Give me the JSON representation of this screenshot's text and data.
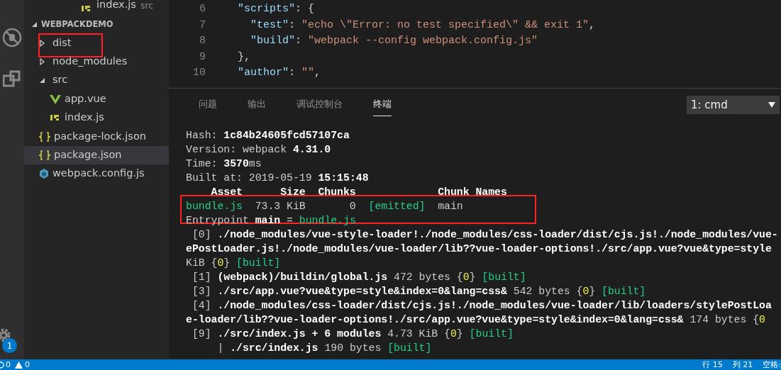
{
  "activity_bar": {
    "badge": "1"
  },
  "open_editor": {
    "name": "index.js",
    "kind": "js",
    "description": "src"
  },
  "explorer": {
    "title": "WEBPACKDEMO",
    "expanded": true,
    "items": [
      {
        "name": "dist",
        "kind": "folder",
        "expanded": false,
        "selected": false,
        "highlighted": true
      },
      {
        "name": "node_modules",
        "kind": "folder",
        "expanded": false,
        "selected": false,
        "highlighted": false
      },
      {
        "name": "src",
        "kind": "folder",
        "expanded": true,
        "selected": false,
        "highlighted": false,
        "children": [
          {
            "name": "app.vue",
            "kind": "vue",
            "selected": false,
            "highlighted": false
          },
          {
            "name": "index.js",
            "kind": "js",
            "selected": false,
            "highlighted": false
          }
        ]
      },
      {
        "name": "package-lock.json",
        "kind": "json",
        "selected": false,
        "highlighted": false
      },
      {
        "name": "package.json",
        "kind": "json",
        "selected": true,
        "highlighted": false
      },
      {
        "name": "webpack.config.js",
        "kind": "webpack",
        "selected": false,
        "highlighted": false
      }
    ]
  },
  "editor": {
    "lines": [
      {
        "number": "6",
        "tokens": [
          {
            "text": "  \"scripts\"",
            "kind": "key"
          },
          {
            "text": ": {",
            "kind": "punct"
          }
        ]
      },
      {
        "number": "7",
        "tokens": [
          {
            "text": "    \"test\"",
            "kind": "key"
          },
          {
            "text": ": ",
            "kind": "punct"
          },
          {
            "text": "\"echo \\\"Error: no test specified\\\" && exit 1\"",
            "kind": "string"
          },
          {
            "text": ",",
            "kind": "punct"
          }
        ]
      },
      {
        "number": "8",
        "tokens": [
          {
            "text": "    \"build\"",
            "kind": "key"
          },
          {
            "text": ": ",
            "kind": "punct"
          },
          {
            "text": "\"webpack --config webpack.config.js\"",
            "kind": "string"
          }
        ]
      },
      {
        "number": "9",
        "tokens": [
          {
            "text": "  },",
            "kind": "punct"
          }
        ]
      },
      {
        "number": "10",
        "tokens": [
          {
            "text": "  \"author\"",
            "kind": "key"
          },
          {
            "text": ": ",
            "kind": "punct"
          },
          {
            "text": "\"\"",
            "kind": "string"
          },
          {
            "text": ",",
            "kind": "punct"
          }
        ]
      }
    ]
  },
  "panel": {
    "tabs": [
      {
        "label": "问题",
        "selected": false
      },
      {
        "label": "输出",
        "selected": false
      },
      {
        "label": "调试控制台",
        "selected": false
      },
      {
        "label": "终端",
        "selected": true
      }
    ],
    "terminal_select": "1: cmd",
    "terminal_lines": [
      {
        "highlighted": false,
        "segments": [
          {
            "text": "Hash: ",
            "kind": "plain"
          },
          {
            "text": "1c84b24605fcd57107ca",
            "kind": "bold"
          }
        ]
      },
      {
        "highlighted": false,
        "segments": [
          {
            "text": "Version: webpack ",
            "kind": "plain"
          },
          {
            "text": "4.31.0",
            "kind": "bold"
          }
        ]
      },
      {
        "highlighted": false,
        "segments": [
          {
            "text": "Time: ",
            "kind": "plain"
          },
          {
            "text": "3570",
            "kind": "bold"
          },
          {
            "text": "ms",
            "kind": "plain"
          }
        ]
      },
      {
        "highlighted": false,
        "segments": [
          {
            "text": "Built at: 2019-05-19 ",
            "kind": "plain"
          },
          {
            "text": "15:15:48",
            "kind": "bold"
          }
        ]
      },
      {
        "highlighted": false,
        "segments": [
          {
            "text": "    Asset      Size  Chunks             Chunk Names",
            "kind": "bold"
          }
        ]
      },
      {
        "highlighted": true,
        "segments": [
          {
            "text": "bundle.js",
            "kind": "green"
          },
          {
            "text": "  73.3 KiB       0  ",
            "kind": "plain"
          },
          {
            "text": "[emitted]",
            "kind": "green"
          },
          {
            "text": "  main",
            "kind": "plain"
          }
        ]
      },
      {
        "highlighted": false,
        "segments": [
          {
            "text": "Entrypoint ",
            "kind": "plain"
          },
          {
            "text": "main",
            "kind": "bold"
          },
          {
            "text": " = ",
            "kind": "plain"
          },
          {
            "text": "bundle.js",
            "kind": "green"
          }
        ]
      },
      {
        "highlighted": false,
        "segments": [
          {
            "text": " [0] ",
            "kind": "plain"
          },
          {
            "text": "./node_modules/vue-style-loader!./node_modules/css-loader/dist/cjs.js!./node_modules/vue-",
            "kind": "bold"
          }
        ]
      },
      {
        "highlighted": false,
        "segments": [
          {
            "text": "ePostLoader.js!./node_modules/vue-loader/lib??vue-loader-options!./src/app.vue?vue&type=style",
            "kind": "bold"
          }
        ]
      },
      {
        "highlighted": false,
        "segments": [
          {
            "text": "KiB {",
            "kind": "plain"
          },
          {
            "text": "0",
            "kind": "yellow"
          },
          {
            "text": "} ",
            "kind": "plain"
          },
          {
            "text": "[built]",
            "kind": "green"
          }
        ]
      },
      {
        "highlighted": false,
        "segments": [
          {
            "text": " [1] ",
            "kind": "plain"
          },
          {
            "text": "(webpack)/buildin/global.js",
            "kind": "bold"
          },
          {
            "text": " 472 bytes {",
            "kind": "plain"
          },
          {
            "text": "0",
            "kind": "yellow"
          },
          {
            "text": "} ",
            "kind": "plain"
          },
          {
            "text": "[built]",
            "kind": "green"
          }
        ]
      },
      {
        "highlighted": false,
        "segments": [
          {
            "text": " [3] ",
            "kind": "plain"
          },
          {
            "text": "./src/app.vue?vue&type=style&index=0&lang=css&",
            "kind": "bold"
          },
          {
            "text": " 542 bytes {",
            "kind": "plain"
          },
          {
            "text": "0",
            "kind": "yellow"
          },
          {
            "text": "} ",
            "kind": "plain"
          },
          {
            "text": "[built]",
            "kind": "green"
          }
        ]
      },
      {
        "highlighted": false,
        "segments": [
          {
            "text": " [4] ",
            "kind": "plain"
          },
          {
            "text": "./node_modules/css-loader/dist/cjs.js!./node_modules/vue-loader/lib/loaders/stylePostLoa",
            "kind": "bold"
          }
        ]
      },
      {
        "highlighted": false,
        "segments": [
          {
            "text": "e-loader/lib??vue-loader-options!./src/app.vue?vue&type=style&index=0&lang=css&",
            "kind": "bold"
          },
          {
            "text": " 174 bytes {",
            "kind": "plain"
          },
          {
            "text": "0",
            "kind": "yellow"
          }
        ]
      },
      {
        "highlighted": false,
        "segments": [
          {
            "text": " [9] ",
            "kind": "plain"
          },
          {
            "text": "./src/index.js + 6 modules",
            "kind": "bold"
          },
          {
            "text": " 4.73 KiB {",
            "kind": "plain"
          },
          {
            "text": "0",
            "kind": "yellow"
          },
          {
            "text": "} ",
            "kind": "plain"
          },
          {
            "text": "[built]",
            "kind": "green"
          }
        ]
      },
      {
        "highlighted": false,
        "segments": [
          {
            "text": "     | ",
            "kind": "plain"
          },
          {
            "text": "./src/index.js",
            "kind": "bold"
          },
          {
            "text": " 190 bytes ",
            "kind": "plain"
          },
          {
            "text": "[built]",
            "kind": "green"
          }
        ]
      }
    ]
  },
  "status_bar": {
    "errors": "0",
    "warnings": "0",
    "items": [
      "行 15",
      "列 21",
      "空格:"
    ]
  }
}
